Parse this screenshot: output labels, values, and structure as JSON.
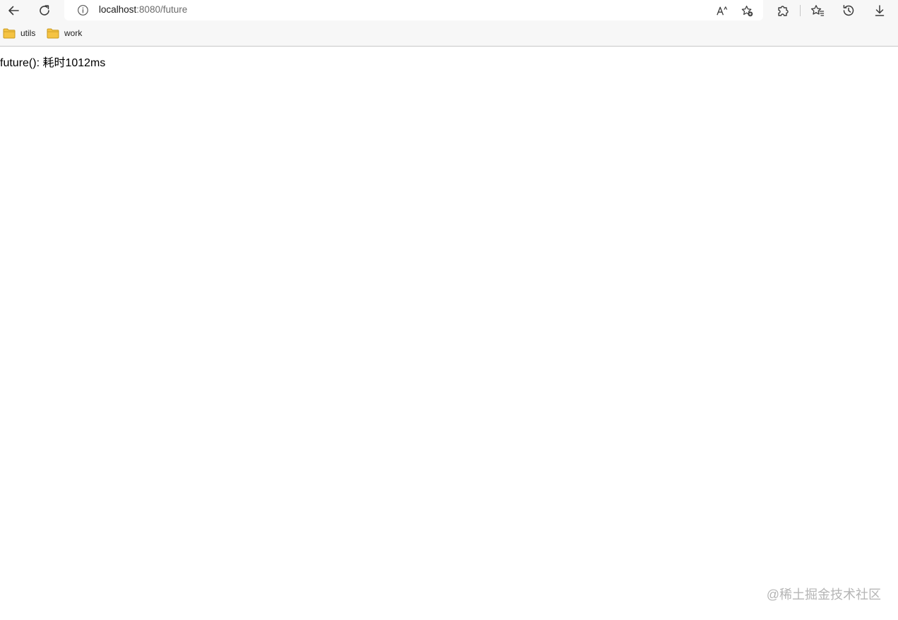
{
  "browser": {
    "address": {
      "host": "localhost",
      "rest": ":8080/future"
    },
    "bookmarks": [
      {
        "label": "utils",
        "icon": "folder-icon"
      },
      {
        "label": "work",
        "icon": "folder-icon"
      }
    ],
    "colors": {
      "folder": "#f5c342",
      "folder_stroke": "#c99a1e",
      "icon": "#3b3b3b"
    }
  },
  "page": {
    "result_text": "future(): 耗时1012ms"
  },
  "watermark": {
    "text": "@稀土掘金技术社区"
  }
}
